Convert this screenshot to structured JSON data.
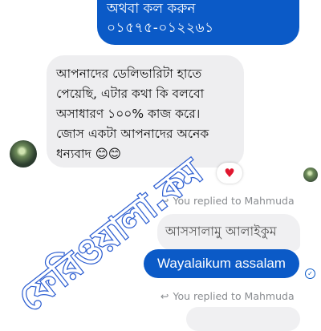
{
  "top_message": {
    "line1": "অথবা কল করুন",
    "line2": "০১৫৭৫-০১২২৬১"
  },
  "received_message": {
    "lines": [
      "আপনাদের ডেলিভারিটা হাতে",
      "পেয়েছি,  এটার কথা কি বলবো",
      "অসাধারণ ১০০% কাজ করে।",
      "জোস একটা আপনাদের অনেক",
      "ধন্যবাদ 😊😊"
    ],
    "reaction": "♥"
  },
  "reply_block_1": {
    "replied_label": "You replied to Mahmuda",
    "quoted_text": "আসসালামু আলাইকুম",
    "reply_text": "Wayalaikum assalam",
    "status_icon": "check-circle-icon"
  },
  "reply_block_2": {
    "replied_label": "You replied to Mahmuda"
  },
  "watermark": {
    "text": "ফেরিওয়ালা.কম"
  },
  "colors": {
    "sent_bubble": "#0b5ac7",
    "received_bubble": "#eeeef0",
    "meta_text": "#8a8d91",
    "reaction": "#e0172f",
    "watermark": "#2e5fd1"
  }
}
